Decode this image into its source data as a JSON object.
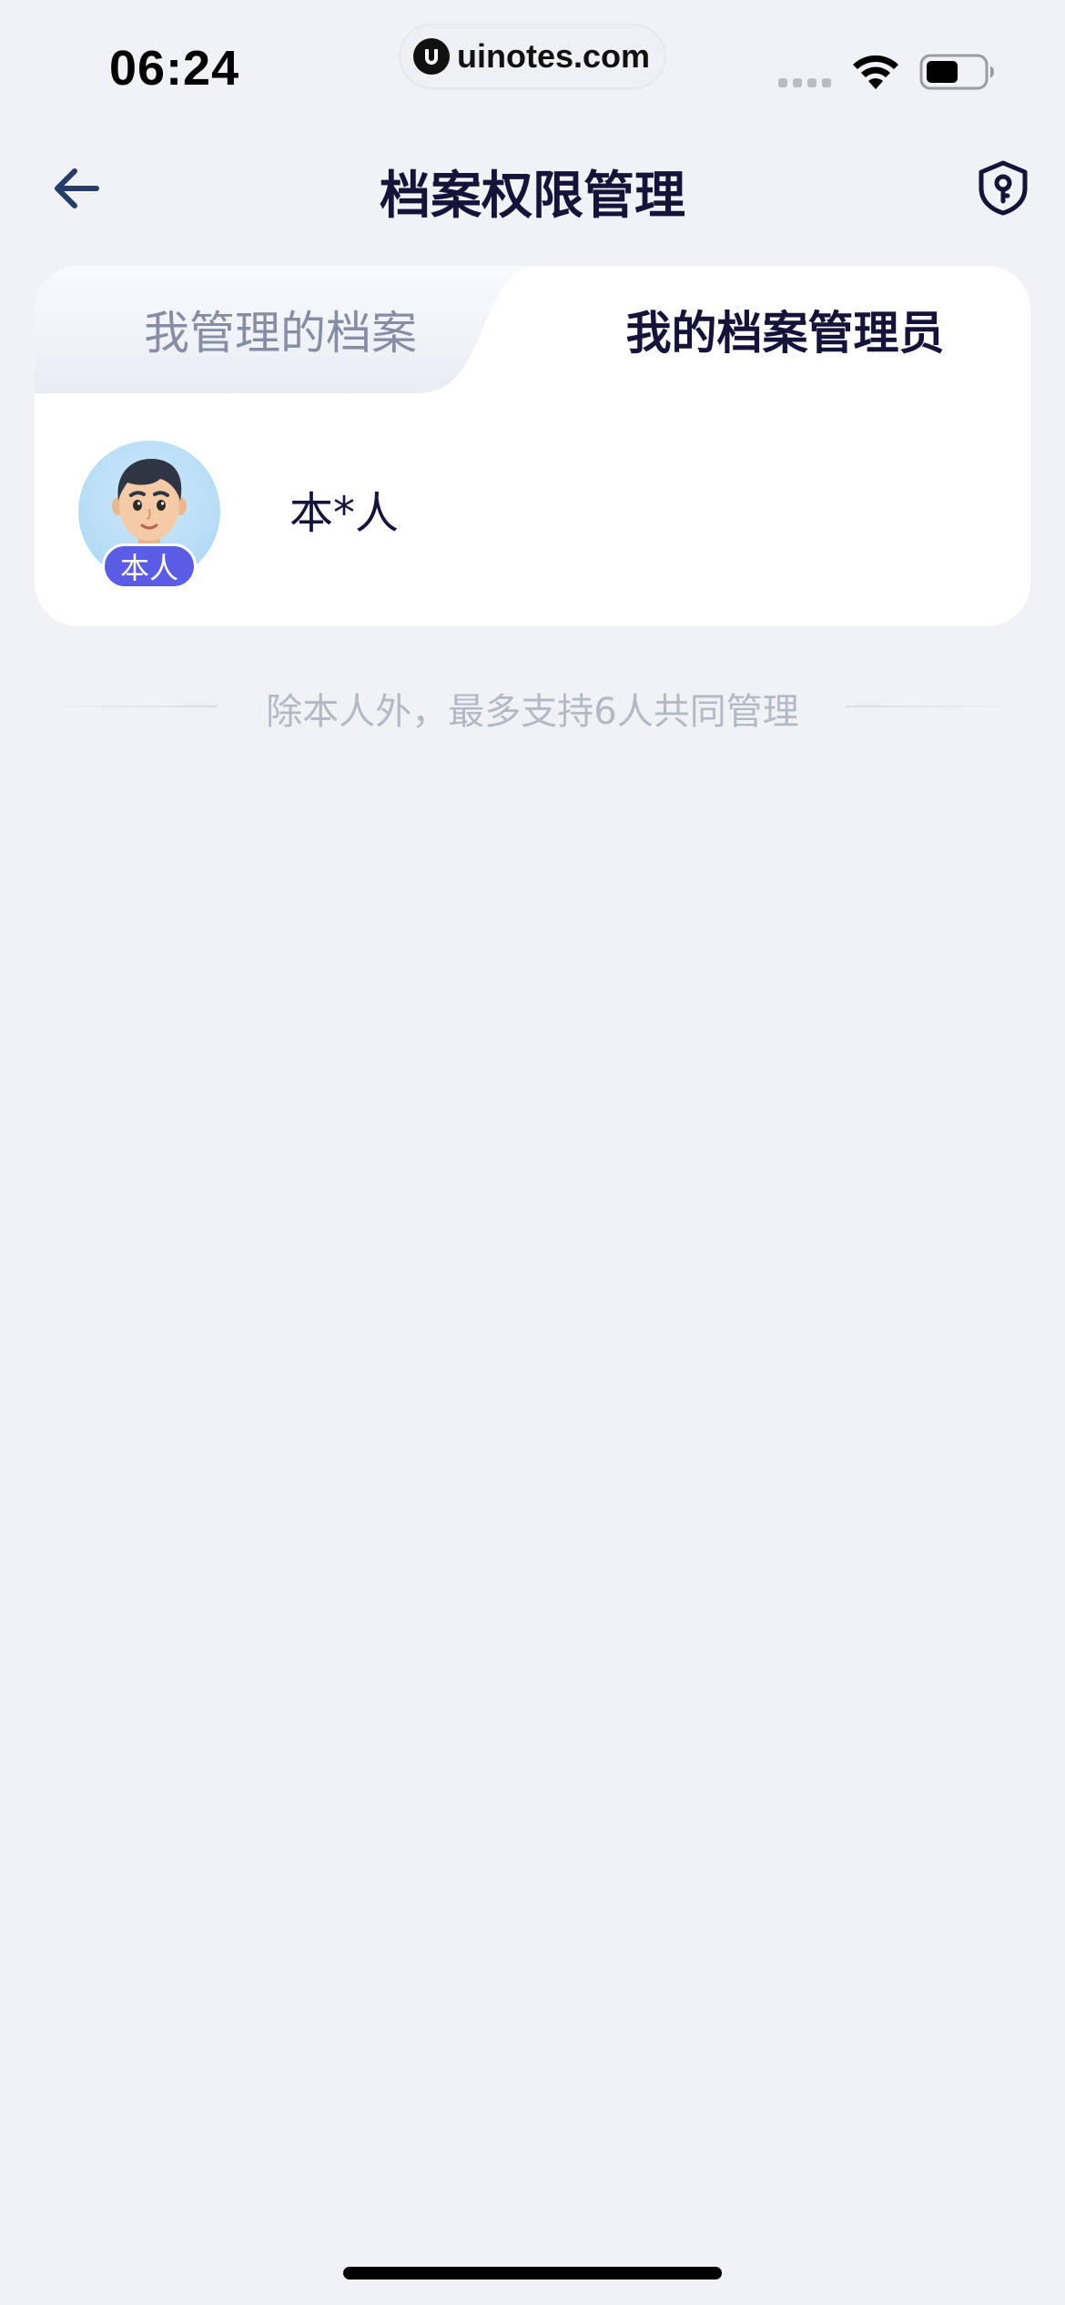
{
  "status_bar": {
    "time": "06:24",
    "watermark": "uinotes.com",
    "icons": [
      "signal-icon",
      "wifi-icon",
      "battery-icon"
    ]
  },
  "nav": {
    "title": "档案权限管理",
    "back_icon": "arrow-left-icon",
    "action_icon": "shield-key-icon"
  },
  "tabs": [
    {
      "label": "我管理的档案",
      "selected": false
    },
    {
      "label": "我的档案管理员",
      "selected": true
    }
  ],
  "members": [
    {
      "name": "本*人",
      "badge": "本人"
    }
  ],
  "note": "除本人外，最多支持6人共同管理",
  "colors": {
    "background": "#f0f2f6",
    "title": "#15133a",
    "badge": "#5b5ce6",
    "tab_inactive": "#878da4",
    "note": "#b4b9c6"
  }
}
